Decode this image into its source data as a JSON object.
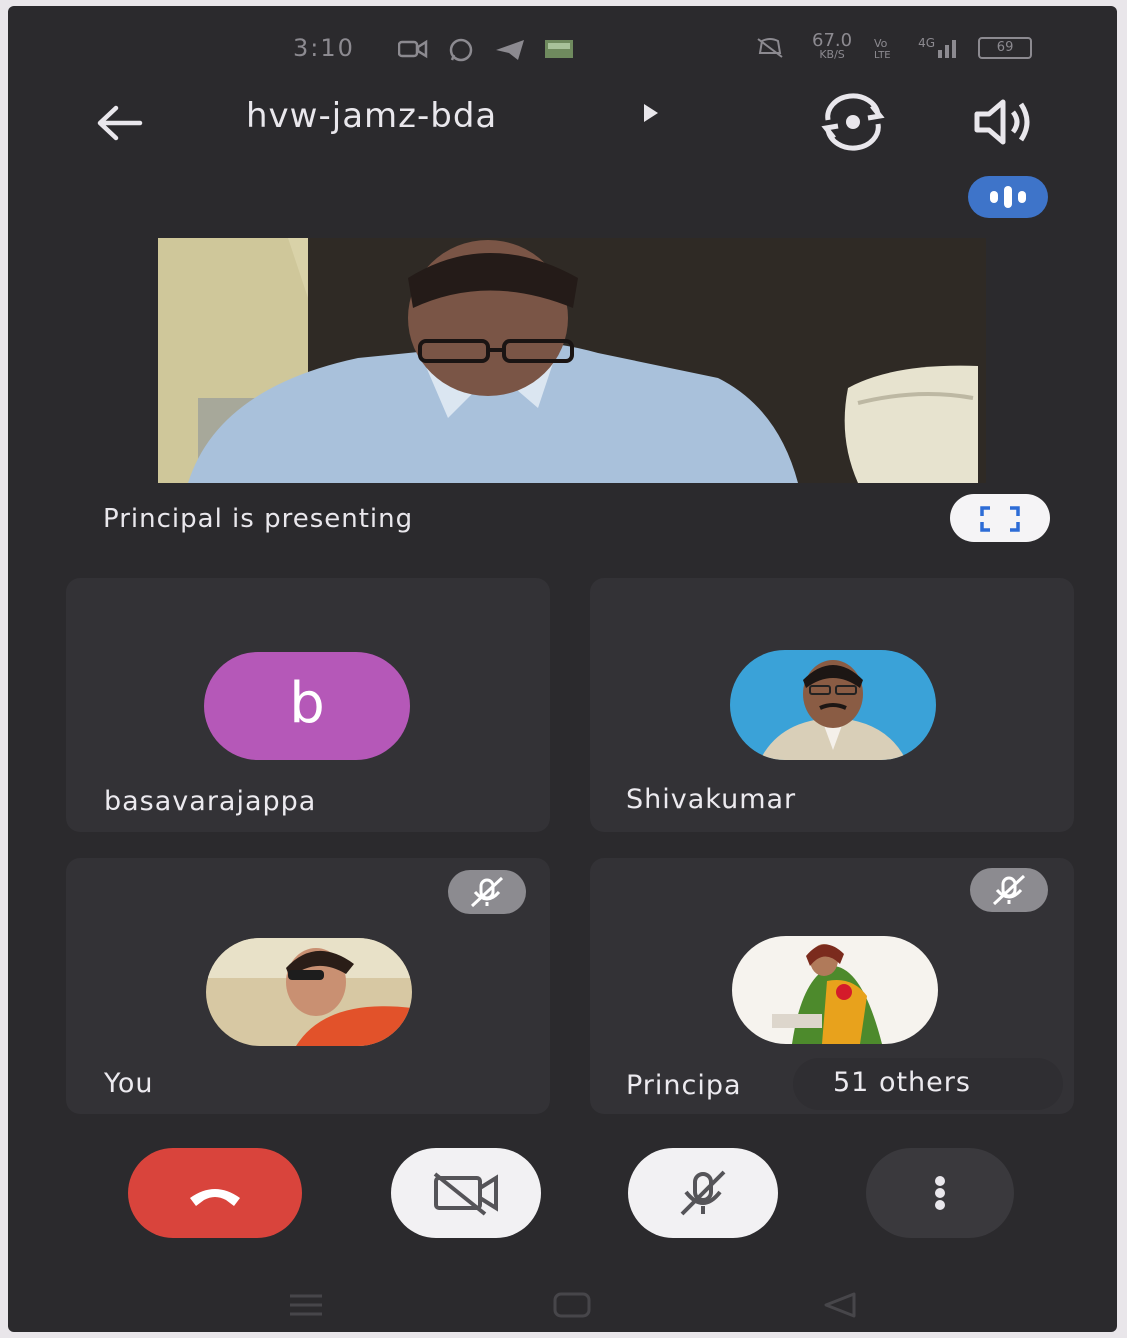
{
  "status_bar": {
    "time": "3:10",
    "net_speed": "67.0",
    "net_speed_unit": "KB/S",
    "signal_type": "4G",
    "battery": "69",
    "icons": [
      "video-icon",
      "whatsapp-icon",
      "telegram-icon",
      "gallery-icon",
      "mute-bell-icon",
      "volte-icon",
      "signal-icon"
    ]
  },
  "header": {
    "meeting_code": "hvw-jamz-bda",
    "icons": [
      "back-arrow-icon",
      "expand-arrow-icon",
      "switch-camera-icon",
      "speaker-icon"
    ]
  },
  "presentation": {
    "caption": "Principal is presenting",
    "icons": [
      "audio-activity-icon",
      "fullscreen-icon"
    ]
  },
  "participants": [
    {
      "name": "basavarajappa",
      "avatar_letter": "b",
      "avatar_color": "#b558b8",
      "muted": false
    },
    {
      "name": "Shivakumar",
      "muted": false
    },
    {
      "name": "You",
      "muted": true
    },
    {
      "name": "Principa",
      "muted": true
    }
  ],
  "others_label": "51 others",
  "controls": {
    "icons": [
      "end-call-icon",
      "camera-off-icon",
      "mic-off-icon",
      "more-options-icon"
    ],
    "hangup_color": "#d9443c"
  },
  "nav_icons": [
    "menu-icon",
    "home-icon",
    "back-icon"
  ]
}
